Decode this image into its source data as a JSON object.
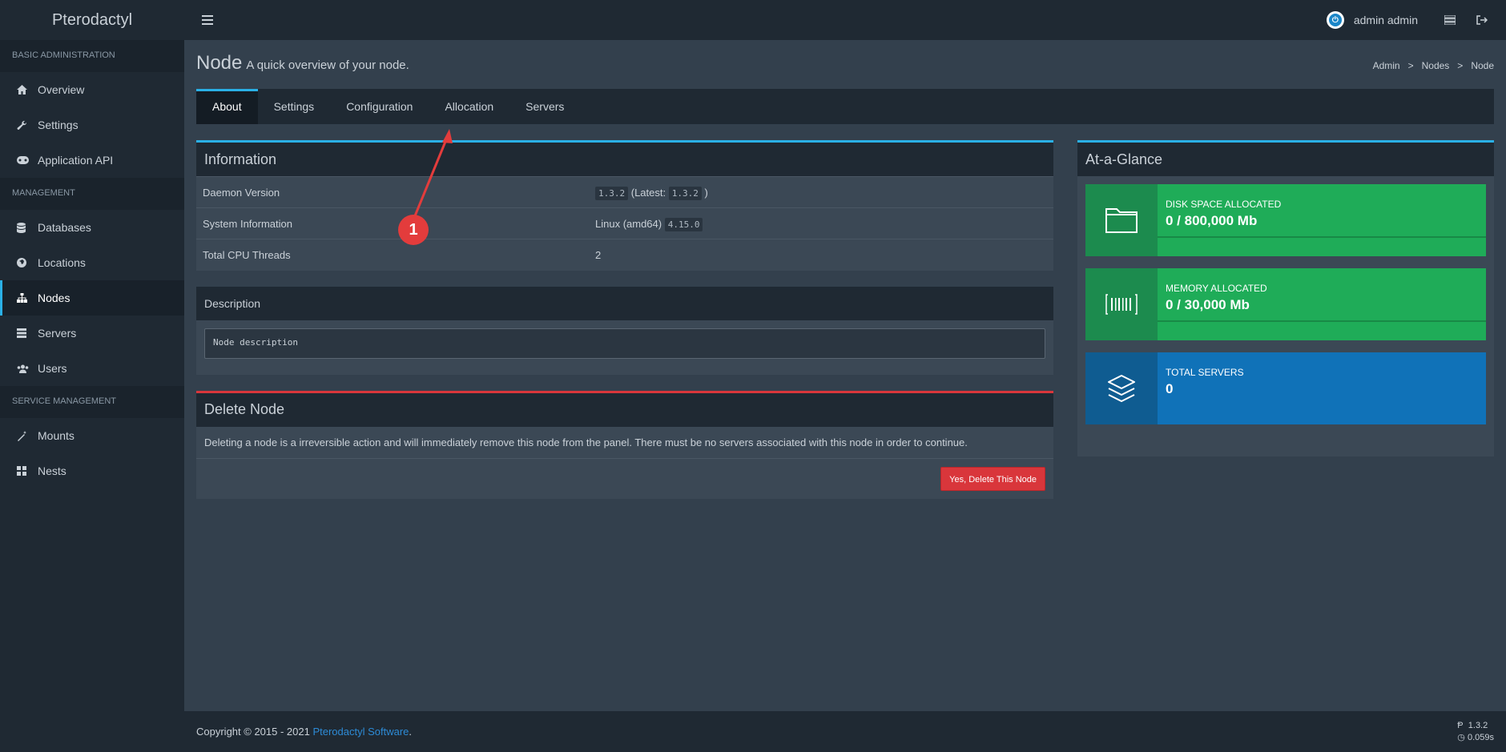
{
  "app": {
    "title": "Pterodactyl"
  },
  "topbar": {
    "user_name": "admin admin",
    "menu_icon": "hamburger-icon",
    "servers_icon": "server-list-icon",
    "logout_icon": "logout-icon"
  },
  "sidebar": {
    "sections": [
      {
        "header": "Basic Administration",
        "items": [
          {
            "label": "Overview",
            "icon": "home-icon"
          },
          {
            "label": "Settings",
            "icon": "wrench-icon"
          },
          {
            "label": "Application API",
            "icon": "gamepad-icon"
          }
        ]
      },
      {
        "header": "Management",
        "items": [
          {
            "label": "Databases",
            "icon": "database-icon"
          },
          {
            "label": "Locations",
            "icon": "globe-icon"
          },
          {
            "label": "Nodes",
            "icon": "sitemap-icon",
            "active": true
          },
          {
            "label": "Servers",
            "icon": "server-icon"
          },
          {
            "label": "Users",
            "icon": "users-icon"
          }
        ]
      },
      {
        "header": "Service Management",
        "items": [
          {
            "label": "Mounts",
            "icon": "magic-icon"
          },
          {
            "label": "Nests",
            "icon": "th-large-icon"
          }
        ]
      }
    ]
  },
  "page": {
    "title": "Node",
    "subtitle": "A quick overview of your node.",
    "breadcrumb": [
      "Admin",
      ">",
      "Nodes",
      ">",
      "Node"
    ]
  },
  "tabs": [
    "About",
    "Settings",
    "Configuration",
    "Allocation",
    "Servers"
  ],
  "information": {
    "title": "Information",
    "rows": [
      {
        "label": "Daemon Version",
        "version": "1.3.2",
        "latest_prefix": "(Latest:",
        "latest": "1.3.2",
        "latest_suffix": ")"
      },
      {
        "label": "System Information",
        "os": "Linux (amd64)",
        "kernel": "4.15.0"
      },
      {
        "label": "Total CPU Threads",
        "value": "2"
      }
    ]
  },
  "description": {
    "title": "Description",
    "value": "Node description"
  },
  "delete_node": {
    "title": "Delete Node",
    "text": "Deleting a node is a irreversible action and will immediately remove this node from the panel. There must be no servers associated with this node in order to continue.",
    "button": "Yes, Delete This Node"
  },
  "glance": {
    "title": "At-a-Glance",
    "boxes": [
      {
        "label": "Disk Space Allocated",
        "value": "0 / 800,000 Mb",
        "icon": "folder-icon",
        "color": "#1fac58",
        "progress": 0
      },
      {
        "label": "Memory Allocated",
        "value": "0 / 30,000 Mb",
        "icon": "barcode-icon",
        "color": "#1fac58",
        "progress": 0
      },
      {
        "label": "Total Servers",
        "value": "0",
        "icon": "layers-icon",
        "color": "#1072b8"
      }
    ]
  },
  "footer": {
    "copyright": "Copyright © 2015 - 2021",
    "link": "Pterodactyl Software",
    "period": ".",
    "version": "1.3.2",
    "time": "0.059s"
  },
  "annotation": {
    "marker": "1"
  }
}
